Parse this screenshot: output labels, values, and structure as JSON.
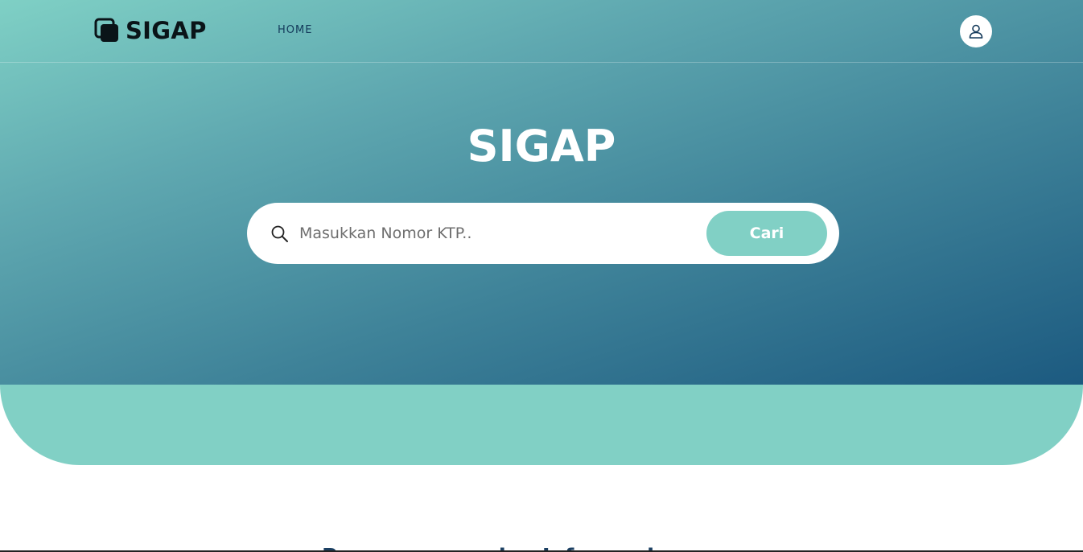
{
  "header": {
    "logo_text": "SIGAP",
    "logo_icon": "stacked-squares-icon",
    "nav": [
      {
        "label": "HOME"
      }
    ],
    "user_icon": "user-icon"
  },
  "hero": {
    "title": "SIGAP"
  },
  "search": {
    "icon": "search-icon",
    "placeholder": "Masukkan Nomor KTP..",
    "value": "",
    "button_label": "Cari"
  },
  "section": {
    "heading": "Pengumuman dan Informasi"
  },
  "colors": {
    "accent": "#81d0c5",
    "gradient_light": "#7fd0c5",
    "gradient_dark": "#1c5a80",
    "nav_text": "#13395a",
    "heading_text": "#1b3f62"
  }
}
